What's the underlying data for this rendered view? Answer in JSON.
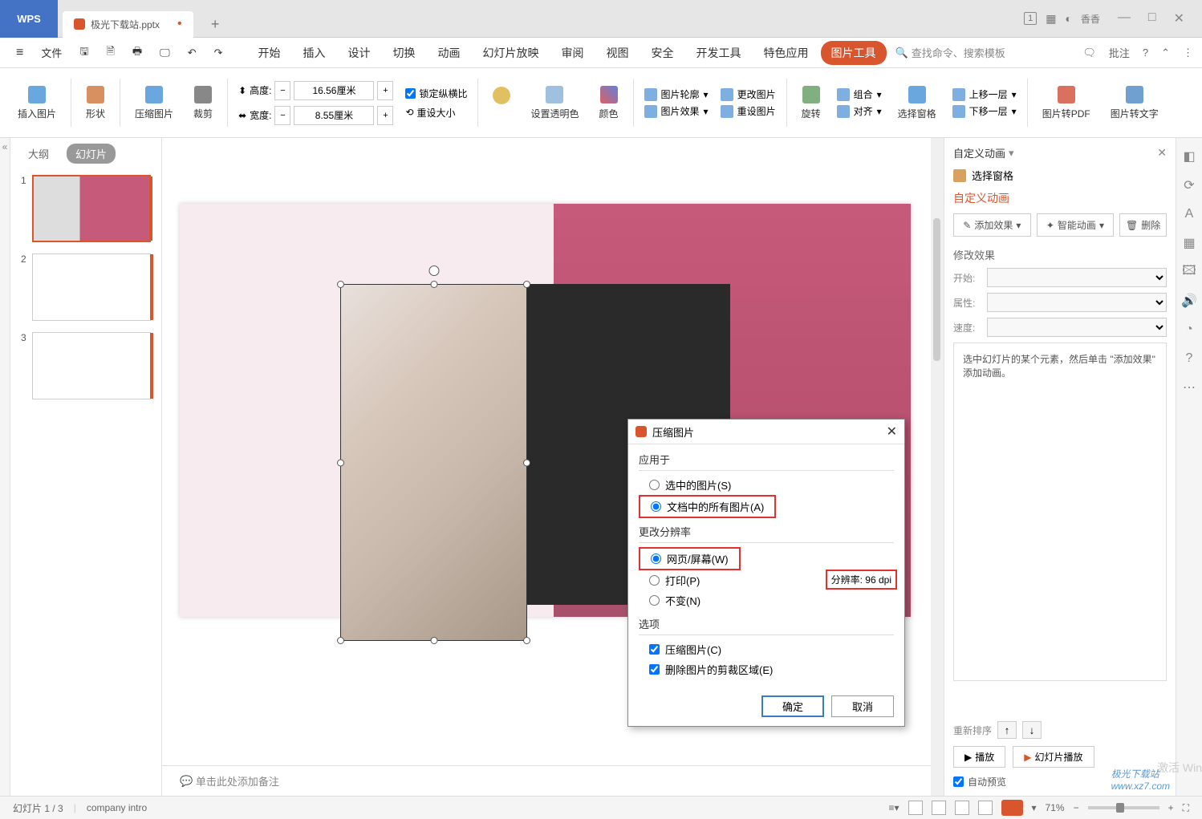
{
  "titlebar": {
    "logo": "WPS",
    "tab": {
      "name": "极光下载站.pptx"
    },
    "user": "香香",
    "badge": "1"
  },
  "menu": {
    "file": "文件",
    "tabs": [
      "开始",
      "插入",
      "设计",
      "切换",
      "动画",
      "幻灯片放映",
      "审阅",
      "视图",
      "安全",
      "开发工具",
      "特色应用",
      "图片工具"
    ],
    "search": "查找命令、搜索模板",
    "right": "批注"
  },
  "ribbon": {
    "insertImg": "插入图片",
    "shape": "形状",
    "compress": "压缩图片",
    "crop": "裁剪",
    "height_label": "高度:",
    "width_label": "宽度:",
    "height_val": "16.56厘米",
    "width_val": "8.55厘米",
    "lock": "锁定纵横比",
    "reset": "重设大小",
    "transparent": "设置透明色",
    "color": "颜色",
    "outline": "图片轮廓",
    "effect": "图片效果",
    "change": "更改图片",
    "resetImg": "重设图片",
    "rotate": "旋转",
    "group": "组合",
    "align": "对齐",
    "up": "上移一层",
    "down": "下移一层",
    "pane": "选择窗格",
    "toPdf": "图片转PDF",
    "toText": "图片转文字"
  },
  "slidePanel": {
    "outline": "大纲",
    "slides": "幻灯片",
    "nums": [
      "1",
      "2",
      "3"
    ]
  },
  "dialog": {
    "title": "压缩图片",
    "applyTo": "应用于",
    "selected": "选中的图片(S)",
    "allDoc": "文档中的所有图片(A)",
    "changeRes": "更改分辨率",
    "web": "网页/屏幕(W)",
    "print": "打印(P)",
    "nochange": "不变(N)",
    "dpi": "分辨率: 96 dpi",
    "options": "选项",
    "compressChk": "压缩图片(C)",
    "deleteCrop": "删除图片的剪裁区域(E)",
    "ok": "确定",
    "cancel": "取消"
  },
  "rightPanel": {
    "title": "自定义动画",
    "selectPane": "选择窗格",
    "heading": "自定义动画",
    "addEffect": "添加效果",
    "smartAnim": "智能动画",
    "delete": "删除",
    "modify": "修改效果",
    "start": "开始:",
    "property": "属性:",
    "speed": "速度:",
    "hint": "选中幻灯片的某个元素，然后单击 \"添加效果\" 添加动画。",
    "reorder": "重新排序",
    "play": "播放",
    "slideshow": "幻灯片播放",
    "autoPreview": "自动预览"
  },
  "notes": "单击此处添加备注",
  "status": {
    "slideInfo": "幻灯片 1 / 3",
    "template": "company intro",
    "zoom": "71%",
    "activate": "激活 Win"
  },
  "watermark": "极光下载站",
  "watermark_url": "www.xz7.com"
}
